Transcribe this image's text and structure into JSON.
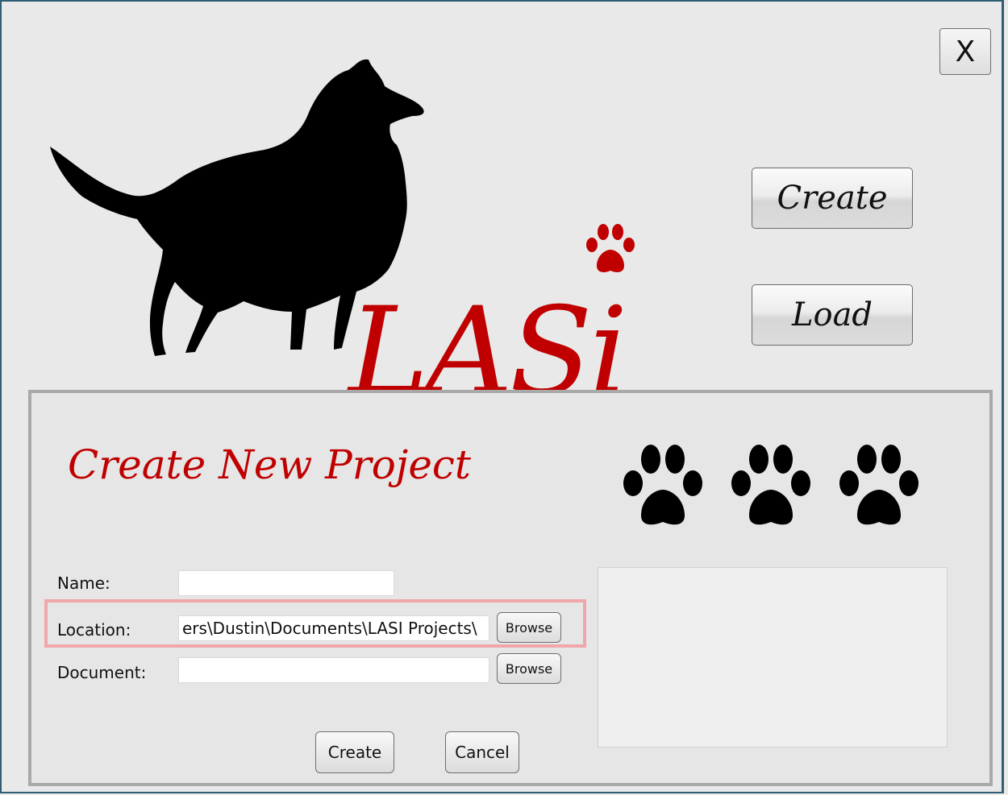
{
  "window": {
    "close_label": "X"
  },
  "logo": {
    "text": "LASi",
    "brand_color": "#c00000"
  },
  "actions": {
    "create_label": "Create",
    "load_label": "Load"
  },
  "panel": {
    "title": "Create New Project",
    "fields": {
      "name_label": "Name:",
      "name_value": "",
      "location_label": "Location:",
      "location_value": "ers\\Dustin\\Documents\\LASI Projects\\",
      "document_label": "Document:",
      "document_value": ""
    },
    "browse_label": "Browse",
    "create_label": "Create",
    "cancel_label": "Cancel"
  }
}
